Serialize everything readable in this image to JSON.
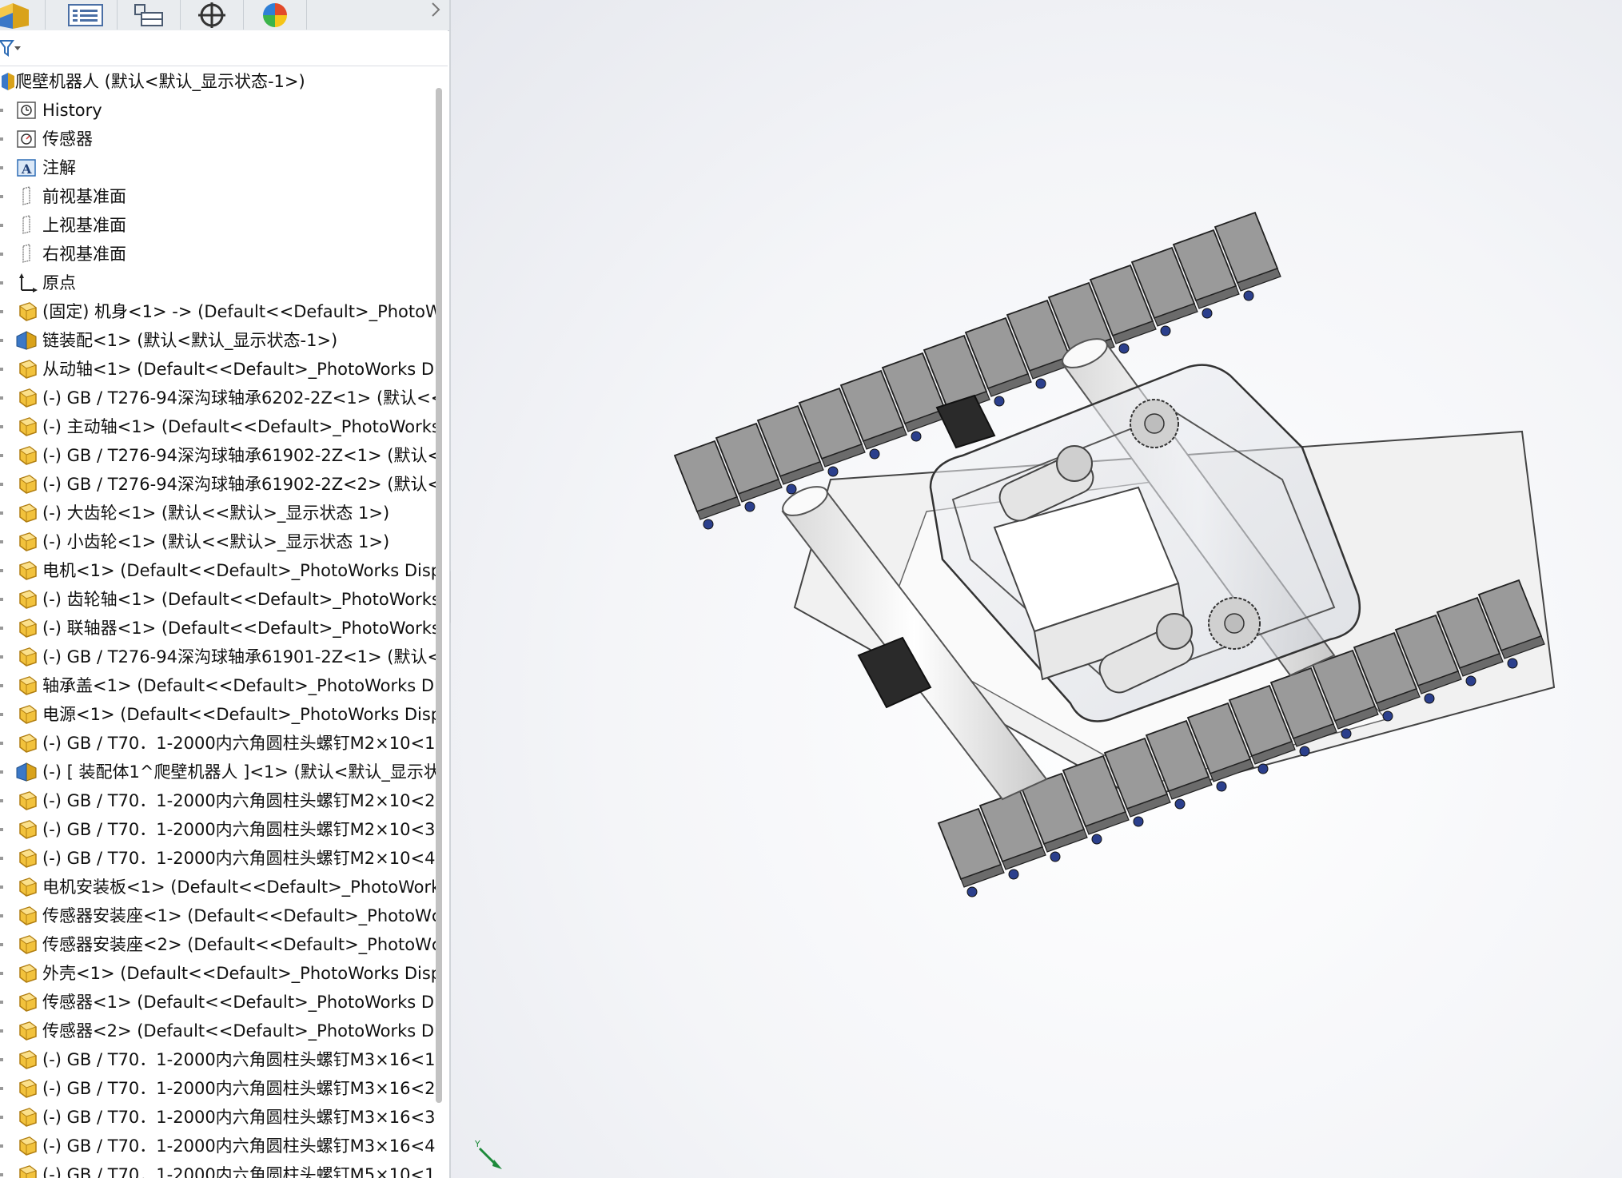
{
  "panel_tabs": [
    {
      "name": "feature-manager-tab",
      "icon": "assembly-cube-icon"
    },
    {
      "name": "property-manager-tab",
      "icon": "property-list-icon"
    },
    {
      "name": "configuration-manager-tab",
      "icon": "configuration-icon"
    },
    {
      "name": "dimxpert-tab",
      "icon": "crosshair-icon"
    },
    {
      "name": "display-manager-tab",
      "icon": "color-wheel-icon"
    }
  ],
  "tree": {
    "root": "爬壁机器人  (默认<默认_显示状态-1>)",
    "items": [
      {
        "label": "History",
        "icon": "history-icon"
      },
      {
        "label": "传感器",
        "icon": "sensor-icon"
      },
      {
        "label": "注解",
        "icon": "annotation-icon"
      },
      {
        "label": "前视基准面",
        "icon": "plane-icon"
      },
      {
        "label": "上视基准面",
        "icon": "plane-icon"
      },
      {
        "label": "右视基准面",
        "icon": "plane-icon"
      },
      {
        "label": "原点",
        "icon": "origin-icon"
      },
      {
        "label": "(固定) 机身<1> -> (Default<<Default>_PhotoW",
        "icon": "part-icon"
      },
      {
        "label": "链装配<1> (默认<默认_显示状态-1>)",
        "icon": "subassembly-icon"
      },
      {
        "label": "从动轴<1> (Default<<Default>_PhotoWorks Di",
        "icon": "part-icon"
      },
      {
        "label": "(-) GB / T276-94深沟球轴承6202-2Z<1> (默认<<",
        "icon": "part-icon"
      },
      {
        "label": "(-) 主动轴<1> (Default<<Default>_PhotoWorks",
        "icon": "part-icon"
      },
      {
        "label": "(-) GB / T276-94深沟球轴承61902-2Z<1> (默认<-",
        "icon": "part-icon"
      },
      {
        "label": "(-) GB / T276-94深沟球轴承61902-2Z<2> (默认<-",
        "icon": "part-icon"
      },
      {
        "label": "(-) 大齿轮<1> (默认<<默认>_显示状态 1>)",
        "icon": "part-icon"
      },
      {
        "label": "(-) 小齿轮<1> (默认<<默认>_显示状态 1>)",
        "icon": "part-icon"
      },
      {
        "label": "电机<1> (Default<<Default>_PhotoWorks Disp",
        "icon": "part-icon"
      },
      {
        "label": "(-) 齿轮轴<1> (Default<<Default>_PhotoWorks",
        "icon": "part-icon"
      },
      {
        "label": "(-) 联轴器<1> (Default<<Default>_PhotoWorks",
        "icon": "part-icon"
      },
      {
        "label": "(-) GB / T276-94深沟球轴承61901-2Z<1> (默认<-",
        "icon": "part-icon"
      },
      {
        "label": "轴承盖<1> (Default<<Default>_PhotoWorks Di",
        "icon": "part-icon"
      },
      {
        "label": "电源<1> (Default<<Default>_PhotoWorks Disp",
        "icon": "part-icon"
      },
      {
        "label": "(-) GB / T70．1-2000内六角圆柱头螺钉M2×10<1:",
        "icon": "part-icon"
      },
      {
        "label": "(-) [ 装配体1^爬壁机器人 ]<1> (默认<默认_显示状",
        "icon": "subassembly-icon"
      },
      {
        "label": "(-) GB / T70．1-2000内六角圆柱头螺钉M2×10<2:",
        "icon": "part-icon"
      },
      {
        "label": "(-) GB / T70．1-2000内六角圆柱头螺钉M2×10<3:",
        "icon": "part-icon"
      },
      {
        "label": "(-) GB / T70．1-2000内六角圆柱头螺钉M2×10<4:",
        "icon": "part-icon"
      },
      {
        "label": "电机安装板<1> (Default<<Default>_PhotoWork",
        "icon": "part-icon"
      },
      {
        "label": "传感器安装座<1> (Default<<Default>_PhotoWc",
        "icon": "part-icon"
      },
      {
        "label": "传感器安装座<2> (Default<<Default>_PhotoWc",
        "icon": "part-icon"
      },
      {
        "label": "外壳<1> (Default<<Default>_PhotoWorks Disp",
        "icon": "part-icon"
      },
      {
        "label": "传感器<1> (Default<<Default>_PhotoWorks Di",
        "icon": "part-icon"
      },
      {
        "label": "传感器<2> (Default<<Default>_PhotoWorks Di",
        "icon": "part-icon"
      },
      {
        "label": "(-) GB / T70．1-2000内六角圆柱头螺钉M3×16<1:",
        "icon": "part-icon"
      },
      {
        "label": "(-) GB / T70．1-2000内六角圆柱头螺钉M3×16<2:",
        "icon": "part-icon"
      },
      {
        "label": "(-) GB / T70．1-2000内六角圆柱头螺钉M3×16<3:",
        "icon": "part-icon"
      },
      {
        "label": "(-) GB / T70．1-2000内六角圆柱头螺钉M3×16<4:",
        "icon": "part-icon"
      },
      {
        "label": "(-) GB / T70．1-2000内六角圆柱头螺钉M5×10<1:",
        "icon": "part-icon"
      }
    ]
  },
  "viewport": {
    "triad_axis_label": "Y",
    "colors": {
      "track_pad": "#9a9a9a",
      "track_pad_side": "#6b6b6b",
      "chain_blue": "#2b3f8c",
      "body_plate": "#f2f2f2",
      "shell": "#dcdfe6",
      "sensor": "#2a2a2a",
      "triad_green": "#1d8a3a"
    }
  }
}
